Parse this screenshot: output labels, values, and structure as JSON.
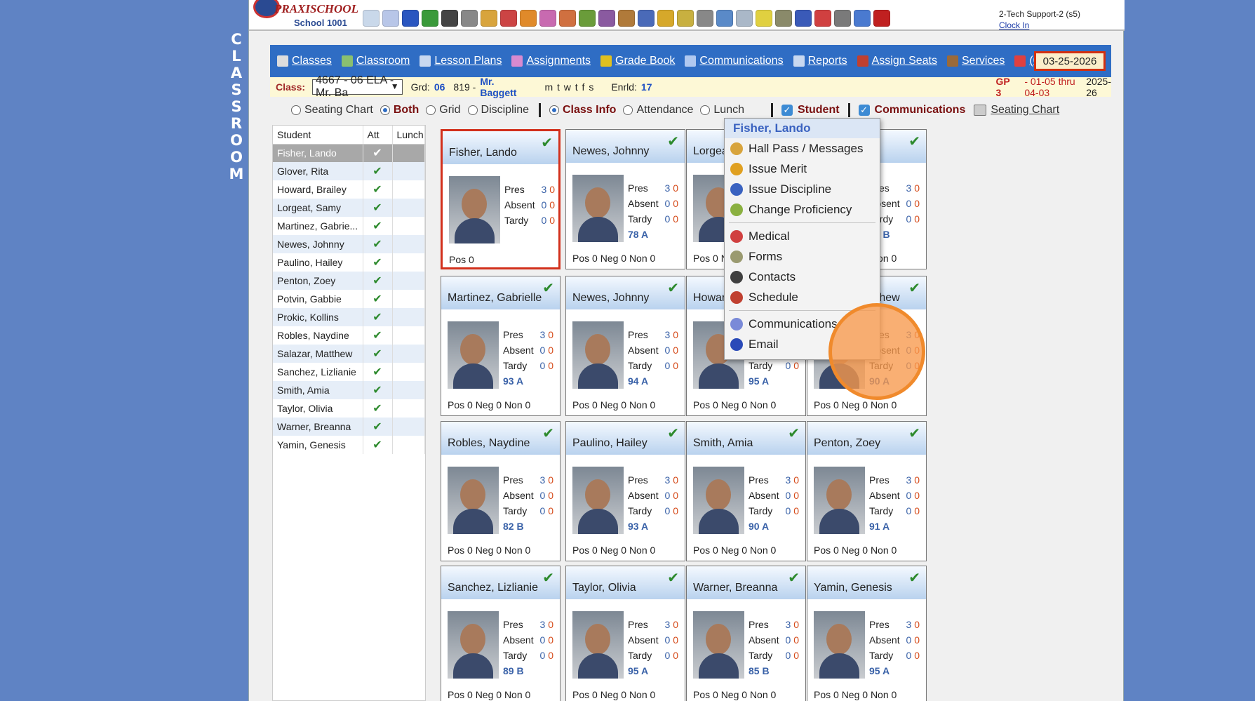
{
  "side_title_letters": [
    "C",
    "L",
    "A",
    "S",
    "S",
    "R",
    "O",
    "O",
    "M"
  ],
  "logo": {
    "brand": "PRAXISCHOOL",
    "school": "School 1001"
  },
  "user": {
    "name": "2-Tech Support-2 (s5)",
    "clock_in": "Clock In"
  },
  "nav": {
    "items": [
      {
        "label": "Classes",
        "icon": "pointer-icon"
      },
      {
        "label": "Classroom",
        "icon": "classroom-icon"
      },
      {
        "label": "Lesson Plans",
        "icon": "book-icon"
      },
      {
        "label": "Assignments",
        "icon": "assignments-icon"
      },
      {
        "label": "Grade Book",
        "icon": "grade-icon"
      },
      {
        "label": "Communications",
        "icon": "communications-icon"
      },
      {
        "label": "Reports",
        "icon": "reports-icon"
      },
      {
        "label": "Assign Seats",
        "icon": "seats-icon"
      },
      {
        "label": "Services",
        "icon": "services-icon"
      },
      {
        "label": "(0)",
        "icon": "messages-icon"
      }
    ],
    "date": "03-25-2026"
  },
  "classbar": {
    "class_label": "Class:",
    "class_value": "4667 - 06 ELA - Mr. Ba",
    "grade_label": "Grd:",
    "grade_value": "06",
    "room": "819 -",
    "teacher": "Mr. Baggett",
    "days": "m t w t f s",
    "enrolled_label": "Enrld:",
    "enrolled_value": "17",
    "gp": "GP 3",
    "range": "- 01-05 thru 04-03",
    "year": "2025-26"
  },
  "options": {
    "radios": [
      {
        "label": "Seating Chart",
        "selected": false
      },
      {
        "label": "Both",
        "selected": true
      },
      {
        "label": "Grid",
        "selected": false
      },
      {
        "label": "Discipline",
        "selected": false
      }
    ],
    "radios2": [
      {
        "label": "Class Info",
        "selected": true
      },
      {
        "label": "Attendance",
        "selected": false
      },
      {
        "label": "Lunch",
        "selected": false
      }
    ],
    "student_check": "Student",
    "communications_check": "Communications",
    "seating_link": "Seating Chart"
  },
  "student_list": {
    "headers": [
      "Student",
      "Att",
      "Lunch"
    ],
    "rows": [
      {
        "name": "Fisher, Lando",
        "att": "✔"
      },
      {
        "name": "Glover, Rita",
        "att": "✔"
      },
      {
        "name": "Howard, Brailey",
        "att": "✔"
      },
      {
        "name": "Lorgeat, Samy",
        "att": "✔"
      },
      {
        "name": "Martinez, Gabrie...",
        "att": "✔"
      },
      {
        "name": "Newes, Johnny",
        "att": "✔"
      },
      {
        "name": "Paulino, Hailey",
        "att": "✔"
      },
      {
        "name": "Penton, Zoey",
        "att": "✔"
      },
      {
        "name": "Potvin, Gabbie",
        "att": "✔"
      },
      {
        "name": "Prokic, Kollins",
        "att": "✔"
      },
      {
        "name": "Robles, Naydine",
        "att": "✔"
      },
      {
        "name": "Salazar, Matthew",
        "att": "✔"
      },
      {
        "name": "Sanchez, Lizlianie",
        "att": "✔"
      },
      {
        "name": "Smith, Amia",
        "att": "✔"
      },
      {
        "name": "Taylor, Olivia",
        "att": "✔"
      },
      {
        "name": "Warner, Breanna",
        "att": "✔"
      },
      {
        "name": "Yamin, Genesis",
        "att": "✔"
      }
    ]
  },
  "stat_labels": {
    "pres": "Pres",
    "absent": "Absent",
    "tardy": "Tardy"
  },
  "cards": [
    {
      "name": "Fisher, Lando",
      "pres": "3",
      "pres2": "0",
      "abs": "0",
      "abs2": "0",
      "tardy": "0",
      "tardy2": "0",
      "grade": "",
      "foot": "Pos 0",
      "active": true
    },
    {
      "name": "Newes, Johnny",
      "pres": "3",
      "pres2": "0",
      "abs": "0",
      "abs2": "0",
      "tardy": "0",
      "tardy2": "0",
      "grade": "78 A",
      "foot": "Pos 0 Neg 0 Non 0"
    },
    {
      "name": "Lorgeat, Samy",
      "pres": "3",
      "pres2": "0",
      "abs": "0",
      "abs2": "0",
      "tardy": "0",
      "tardy2": "0",
      "grade": "87 B",
      "foot": "Pos 0 Neg 0 Non 0"
    },
    {
      "name": "Glover, Rita",
      "pres": "3",
      "pres2": "0",
      "abs": "0",
      "abs2": "0",
      "tardy": "0",
      "tardy2": "0",
      "grade": "89 B",
      "foot": "Pos 0 Neg 0 Non 0"
    },
    {
      "name": "Martinez, Gabrielle",
      "pres": "3",
      "pres2": "0",
      "abs": "0",
      "abs2": "0",
      "tardy": "0",
      "tardy2": "0",
      "grade": "93 A",
      "foot": "Pos 0 Neg 0 Non 0"
    },
    {
      "name": "Newes, Johnny",
      "pres": "3",
      "pres2": "0",
      "abs": "0",
      "abs2": "0",
      "tardy": "0",
      "tardy2": "0",
      "grade": "94 A",
      "foot": "Pos 0 Neg 0 Non 0"
    },
    {
      "name": "Howard, Brailey",
      "pres": "3",
      "pres2": "0",
      "abs": "0",
      "abs2": "0",
      "tardy": "0",
      "tardy2": "0",
      "grade": "95 A",
      "foot": "Pos 0 Neg 0 Non 0"
    },
    {
      "name": "Salazar, Matthew",
      "pres": "3",
      "pres2": "0",
      "abs": "0",
      "abs2": "0",
      "tardy": "0",
      "tardy2": "0",
      "grade": "90 A",
      "foot": "Pos 0 Neg 0 Non 0"
    },
    {
      "name": "Robles, Naydine",
      "pres": "3",
      "pres2": "0",
      "abs": "0",
      "abs2": "0",
      "tardy": "0",
      "tardy2": "0",
      "grade": "82 B",
      "foot": "Pos 0 Neg 0 Non 0"
    },
    {
      "name": "Paulino, Hailey",
      "pres": "3",
      "pres2": "0",
      "abs": "0",
      "abs2": "0",
      "tardy": "0",
      "tardy2": "0",
      "grade": "93 A",
      "foot": "Pos 0 Neg 0 Non 0"
    },
    {
      "name": "Smith, Amia",
      "pres": "3",
      "pres2": "0",
      "abs": "0",
      "abs2": "0",
      "tardy": "0",
      "tardy2": "0",
      "grade": "90 A",
      "foot": "Pos 0 Neg 0 Non 0"
    },
    {
      "name": "Penton, Zoey",
      "pres": "3",
      "pres2": "0",
      "abs": "0",
      "abs2": "0",
      "tardy": "0",
      "tardy2": "0",
      "grade": "91 A",
      "foot": "Pos 0 Neg 0 Non 0"
    },
    {
      "name": "Sanchez, Lizlianie",
      "pres": "3",
      "pres2": "0",
      "abs": "0",
      "abs2": "0",
      "tardy": "0",
      "tardy2": "0",
      "grade": "89 B",
      "foot": "Pos 0 Neg 0 Non 0"
    },
    {
      "name": "Taylor, Olivia",
      "pres": "3",
      "pres2": "0",
      "abs": "0",
      "abs2": "0",
      "tardy": "0",
      "tardy2": "0",
      "grade": "95 A",
      "foot": "Pos 0 Neg 0 Non 0"
    },
    {
      "name": "Warner, Breanna",
      "pres": "3",
      "pres2": "0",
      "abs": "0",
      "abs2": "0",
      "tardy": "0",
      "tardy2": "0",
      "grade": "85 B",
      "foot": "Pos 0 Neg 0 Non 0"
    },
    {
      "name": "Yamin, Genesis",
      "pres": "3",
      "pres2": "0",
      "abs": "0",
      "abs2": "0",
      "tardy": "0",
      "tardy2": "0",
      "grade": "95 A",
      "foot": "Pos 0 Neg 0 Non 0"
    }
  ],
  "context_menu": {
    "title": "Fisher, Lando",
    "items": [
      {
        "label": "Hall Pass / Messages",
        "icon": "hall-pass-icon",
        "color": "#d8a43c"
      },
      {
        "label": "Issue Merit",
        "icon": "merit-icon",
        "color": "#e0a020"
      },
      {
        "label": "Issue Discipline",
        "icon": "discipline-icon",
        "color": "#3a62c0"
      },
      {
        "label": "Change Proficiency",
        "icon": "proficiency-icon",
        "color": "#8ab040"
      },
      {
        "label": "Medical",
        "icon": "medical-icon",
        "color": "#d04040"
      },
      {
        "label": "Forms",
        "icon": "forms-icon",
        "color": "#9a9a70"
      },
      {
        "label": "Contacts",
        "icon": "contacts-icon",
        "color": "#404040"
      },
      {
        "label": "Schedule",
        "icon": "schedule-icon",
        "color": "#c04030"
      },
      {
        "label": "Communications",
        "icon": "communications-icon",
        "color": "#7a8ad8"
      },
      {
        "label": "Email",
        "icon": "email-icon",
        "color": "#2a4ab8"
      }
    ]
  },
  "colors": {
    "background": "#5f83c4",
    "nav": "#2f6dc4",
    "accent_red": "#d2301c",
    "check_green": "#2d8a2d"
  }
}
